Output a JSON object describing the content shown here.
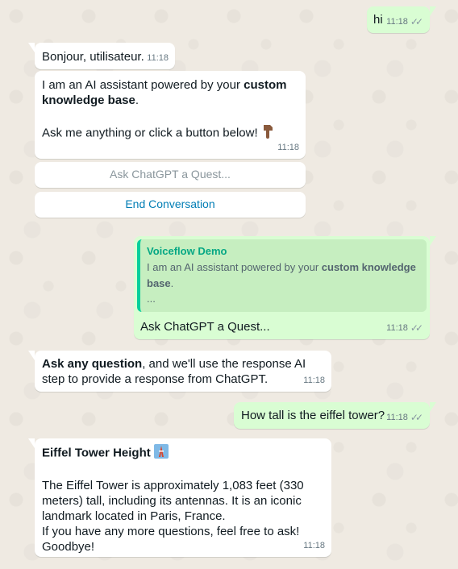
{
  "conversation": {
    "m1": {
      "text": "hi",
      "time": "11:18"
    },
    "m2": {
      "text": "Bonjour, utilisateur.",
      "time": "11:18"
    },
    "m3": {
      "line1_pre": "I am an AI assistant powered by your ",
      "line1_bold": "custom knowledge base",
      "line1_post": ".",
      "line2": "Ask me anything or click a button below!",
      "emoji": "pointing-down-hand-icon",
      "time": "11:18"
    },
    "buttons": {
      "ask_label": "Ask ChatGPT a Quest...",
      "end_label": "End Conversation"
    },
    "m4": {
      "quote_author": "Voiceflow Demo",
      "quote_pre": "I am an AI assistant powered by your ",
      "quote_bold": "custom knowledge base",
      "quote_post": ".",
      "quote_ellipsis": "...",
      "text": "Ask ChatGPT a Quest...",
      "time": "11:18"
    },
    "m5": {
      "bold": "Ask any question",
      "text": ", and we'll use the response AI step to provide a response from ChatGPT.",
      "time": "11:18"
    },
    "m6": {
      "text": "How tall is the eiffel tower?",
      "time": "11:18"
    },
    "m7": {
      "title": "Eiffel Tower Height",
      "title_emoji": "tokyo-tower-icon",
      "body": "The Eiffel Tower is approximately 1,083 feet (330 meters) tall, including its antennas. It is an iconic landmark located in Paris, France.",
      "closing": "If you have any more questions, feel free to ask! Goodbye!",
      "time": "11:18"
    }
  },
  "colors": {
    "background": "#efeae2",
    "incoming_bubble": "#ffffff",
    "outgoing_bubble": "#d9fdd3",
    "quote_accent": "#06cf9c",
    "button_text": "#027eb5"
  },
  "status_icon": "double-check-icon"
}
